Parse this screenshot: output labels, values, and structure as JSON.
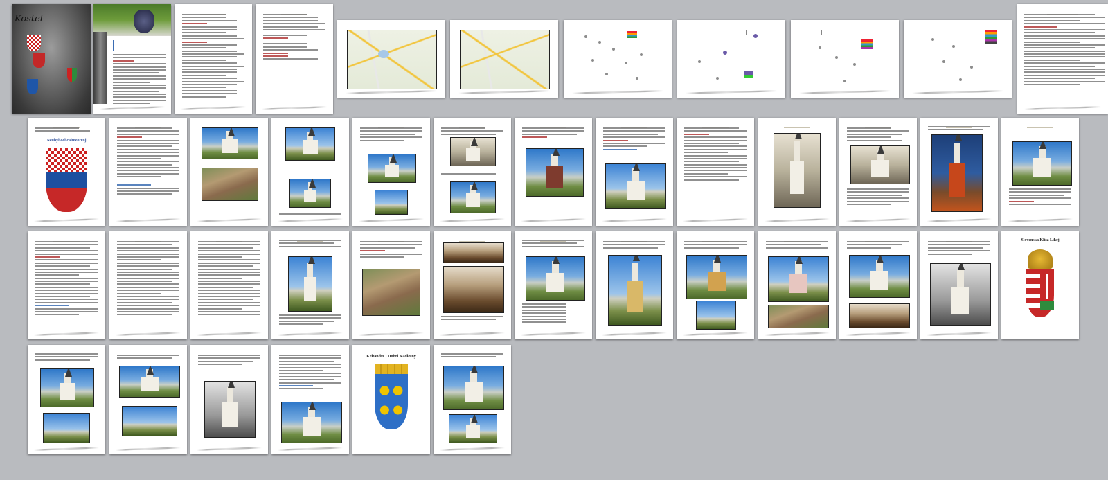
{
  "cover": {
    "title": "Kostel"
  },
  "pages": {
    "p_crest_1_title": "Neubybochcaimeotvoj",
    "p_crest_2_title": "Slovenska Klisz Likej",
    "p_crest_3_title": "Keltandre · Dobri Kadlesny"
  },
  "colors": {
    "background": "#b9bbbf",
    "page": "#ffffff",
    "accent_red": "#b23b3b",
    "accent_blue": "#3d6fb3"
  }
}
